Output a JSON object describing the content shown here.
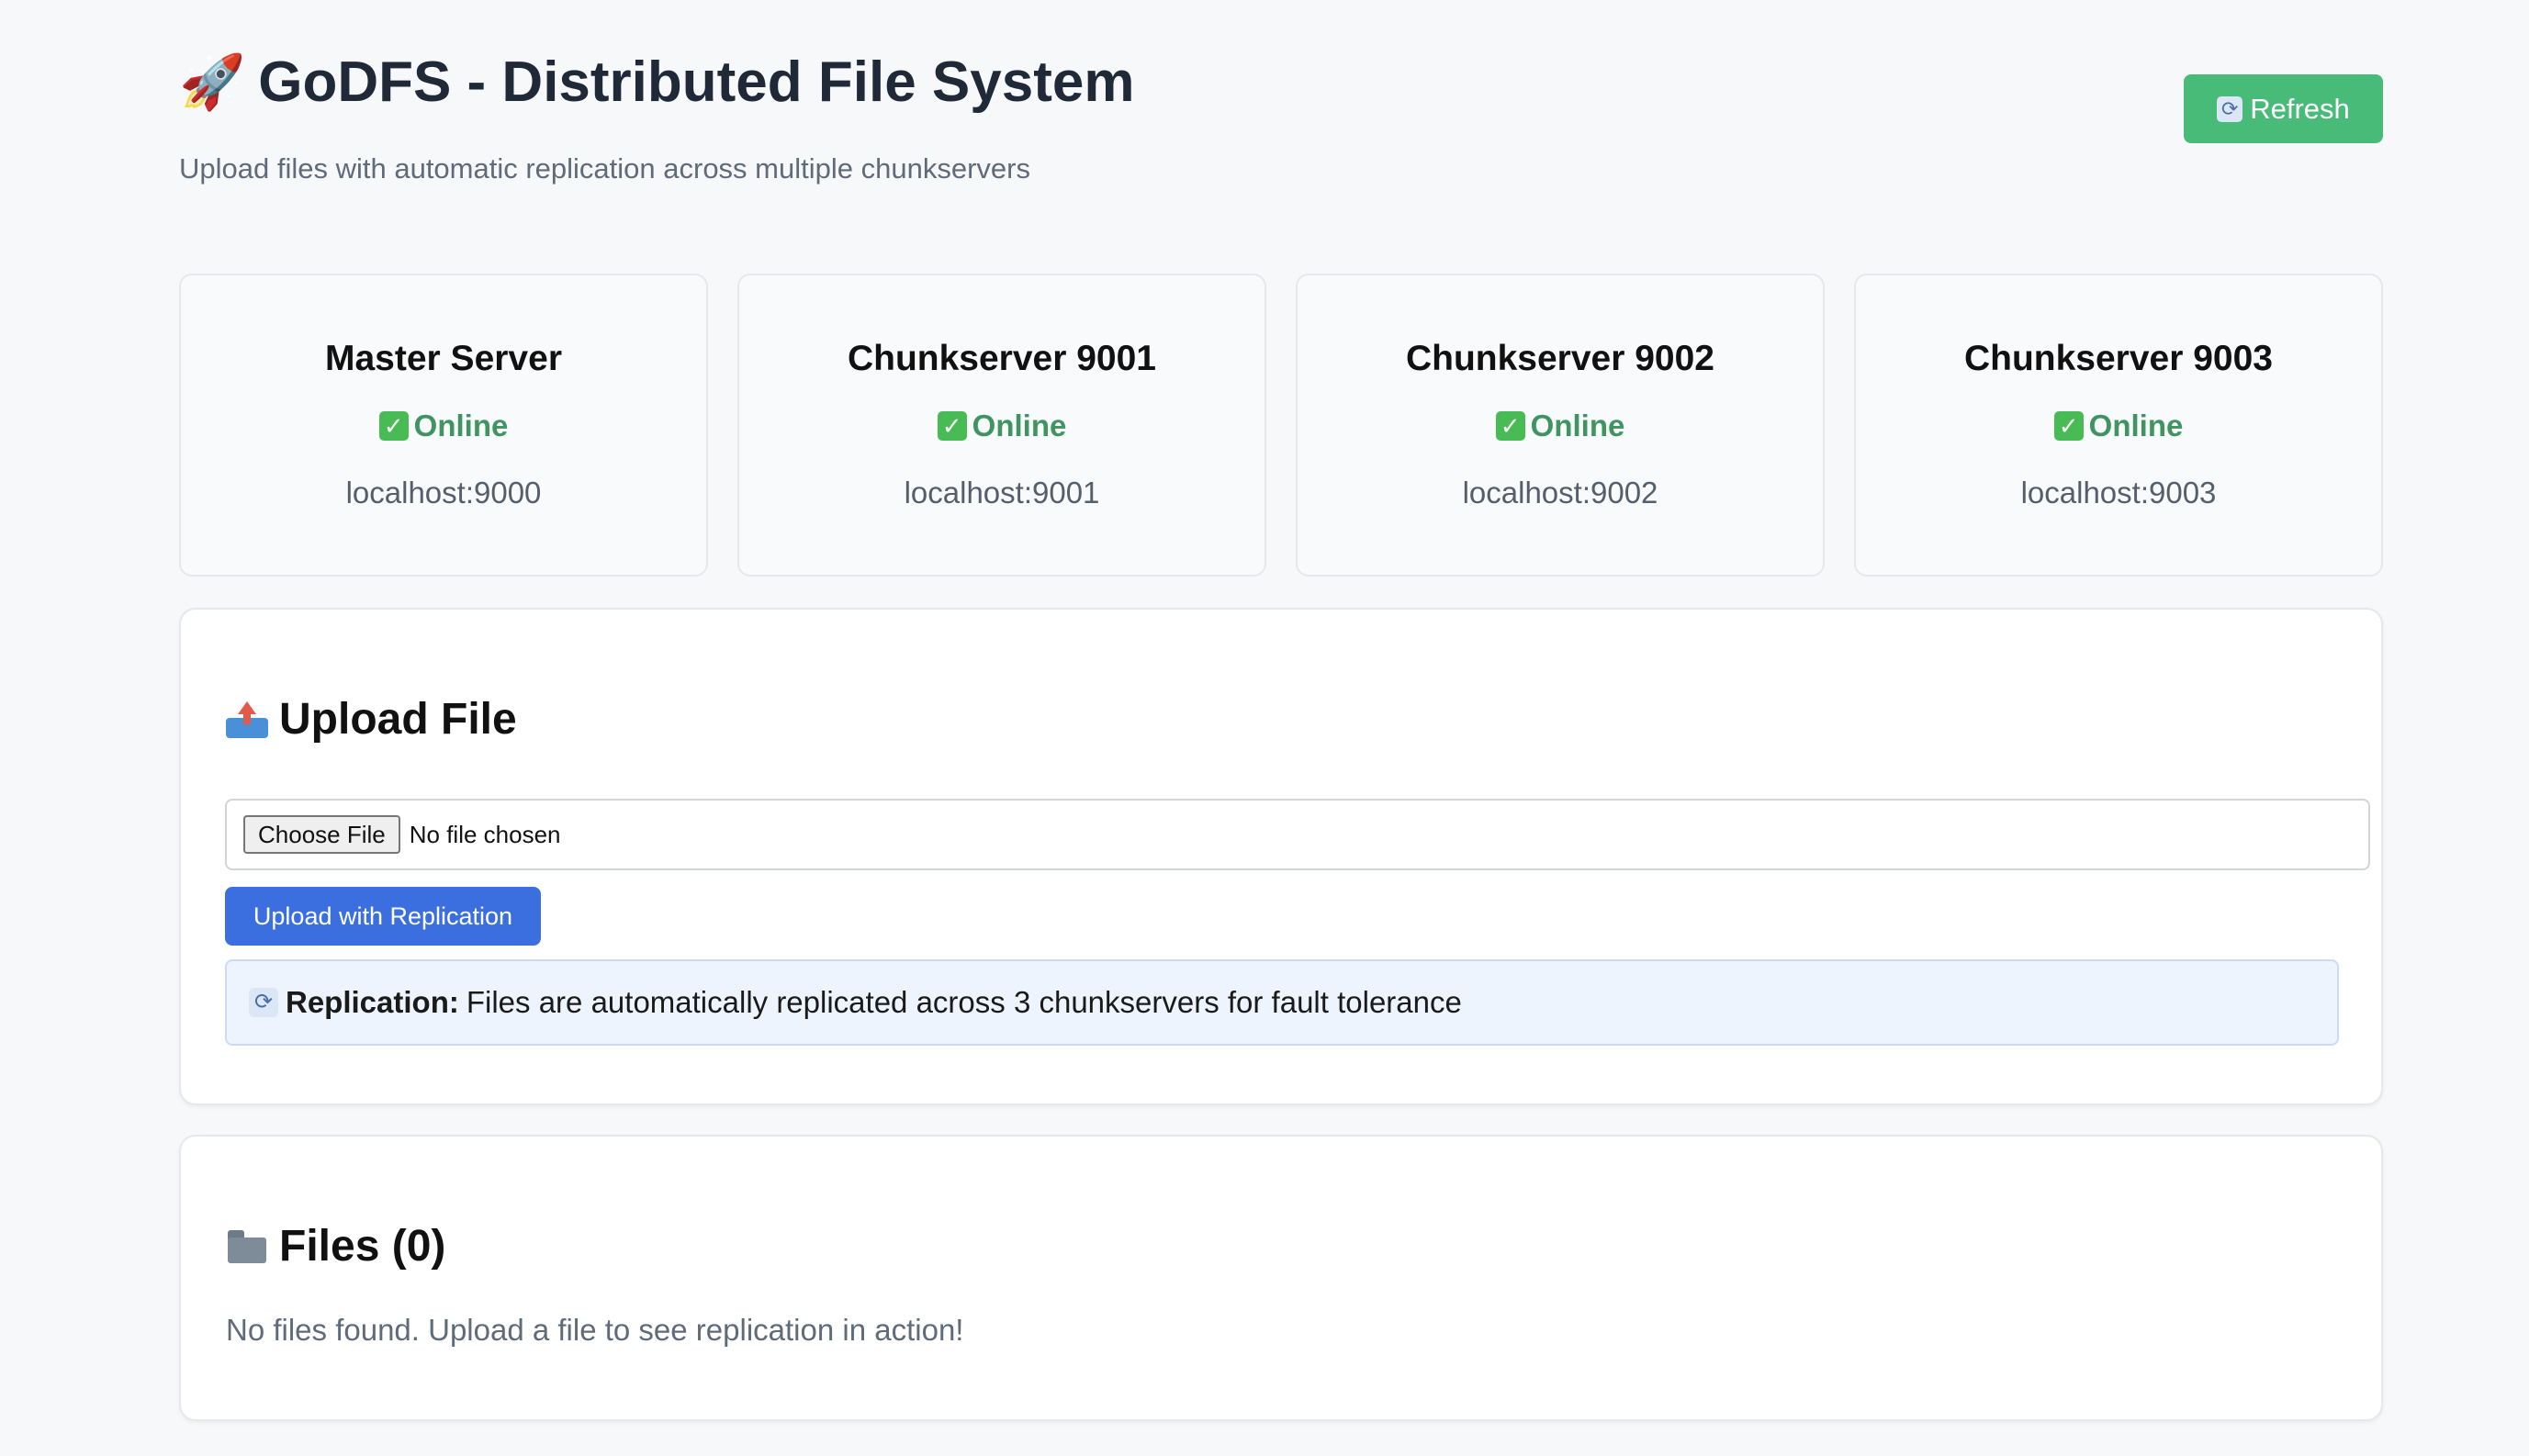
{
  "header": {
    "title_icon": "rocket-icon",
    "title": "GoDFS - Distributed File System",
    "subtitle": "Upload files with automatic replication across multiple chunkservers",
    "refresh_label": "Refresh"
  },
  "servers": [
    {
      "name": "Master Server",
      "status": "Online",
      "address": "localhost:9000"
    },
    {
      "name": "Chunkserver 9001",
      "status": "Online",
      "address": "localhost:9001"
    },
    {
      "name": "Chunkserver 9002",
      "status": "Online",
      "address": "localhost:9002"
    },
    {
      "name": "Chunkserver 9003",
      "status": "Online",
      "address": "localhost:9003"
    }
  ],
  "upload": {
    "title": "Upload File",
    "choose_file_label": "Choose File",
    "file_status": "No file chosen",
    "upload_button": "Upload with Replication",
    "info_label": "Replication:",
    "info_text": "Files are automatically replicated across 3 chunkservers for fault tolerance"
  },
  "files": {
    "title": "Files (0)",
    "empty_message": "No files found. Upload a file to see replication in action!"
  },
  "colors": {
    "background": "#f7f8fa",
    "refresh_button": "#48bb78",
    "upload_button": "#3b6fe0",
    "online_status": "#3f9460",
    "info_background": "#eef4fd"
  }
}
